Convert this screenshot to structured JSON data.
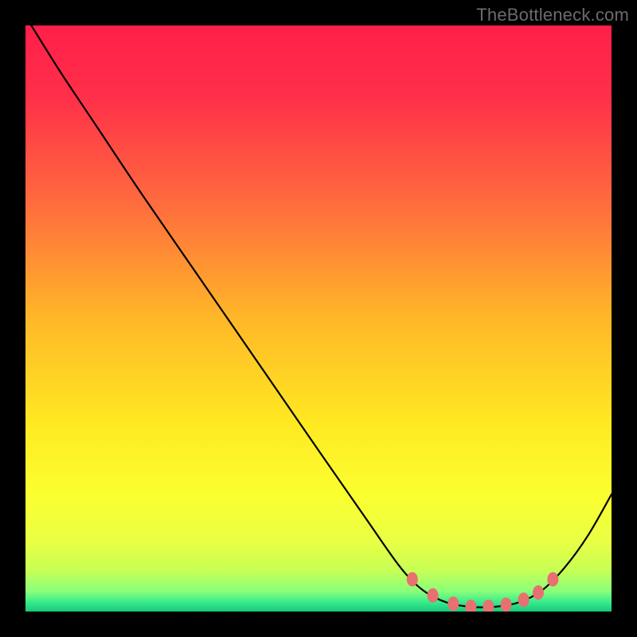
{
  "watermark": "TheBottleneck.com",
  "chart_data": {
    "type": "line",
    "title": "",
    "xlabel": "",
    "ylabel": "",
    "xlim": [
      0,
      100
    ],
    "ylim": [
      0,
      100
    ],
    "gradient_stops": [
      {
        "offset": 0.0,
        "color": "#ff1f49"
      },
      {
        "offset": 0.12,
        "color": "#ff2f49"
      },
      {
        "offset": 0.3,
        "color": "#ff6a3e"
      },
      {
        "offset": 0.5,
        "color": "#ffb728"
      },
      {
        "offset": 0.68,
        "color": "#ffe922"
      },
      {
        "offset": 0.8,
        "color": "#fbff2f"
      },
      {
        "offset": 0.88,
        "color": "#e9ff44"
      },
      {
        "offset": 0.93,
        "color": "#c7ff55"
      },
      {
        "offset": 0.965,
        "color": "#8cff7a"
      },
      {
        "offset": 0.985,
        "color": "#35e98c"
      },
      {
        "offset": 1.0,
        "color": "#17c97a"
      }
    ],
    "series": [
      {
        "name": "bottleneck-curve",
        "points": [
          {
            "x": 1.0,
            "y": 100.0
          },
          {
            "x": 6.0,
            "y": 92.0
          },
          {
            "x": 12.0,
            "y": 83.0
          },
          {
            "x": 20.0,
            "y": 71.0
          },
          {
            "x": 30.0,
            "y": 56.5
          },
          {
            "x": 40.0,
            "y": 42.0
          },
          {
            "x": 50.0,
            "y": 27.5
          },
          {
            "x": 58.0,
            "y": 16.0
          },
          {
            "x": 64.0,
            "y": 7.5
          },
          {
            "x": 68.0,
            "y": 3.5
          },
          {
            "x": 72.0,
            "y": 1.5
          },
          {
            "x": 76.0,
            "y": 0.8
          },
          {
            "x": 80.0,
            "y": 0.8
          },
          {
            "x": 84.0,
            "y": 1.5
          },
          {
            "x": 88.0,
            "y": 3.5
          },
          {
            "x": 92.0,
            "y": 7.5
          },
          {
            "x": 96.0,
            "y": 13.0
          },
          {
            "x": 100.0,
            "y": 20.0
          }
        ]
      }
    ],
    "optimal_markers_x": [
      66,
      69.5,
      73,
      76,
      79,
      82,
      85,
      87.5,
      90
    ],
    "marker_style": {
      "fill": "#e87070",
      "rx": 7,
      "ry": 9
    }
  }
}
